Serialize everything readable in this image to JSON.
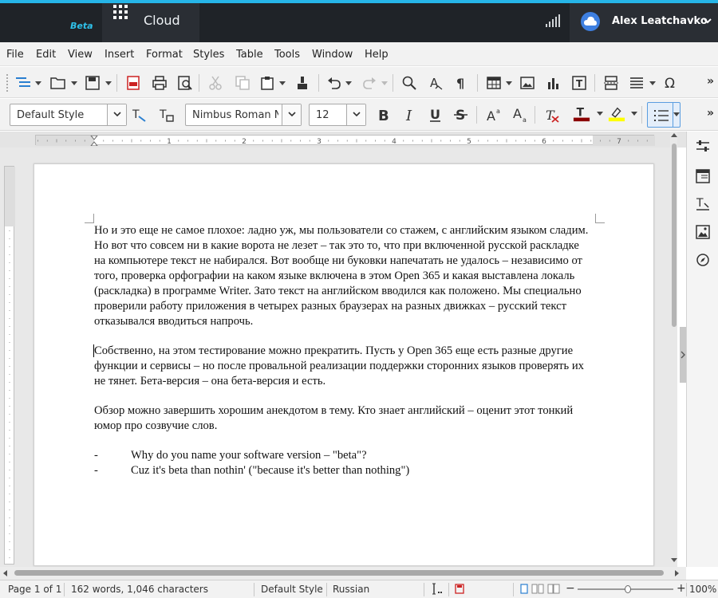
{
  "app": {
    "beta_label": "Beta",
    "product_name": "Cloud",
    "user_name": "Alex Leatchavko",
    "accent": "#26b5e8",
    "header_bg": "#1f2328"
  },
  "menu": [
    "File",
    "Edit",
    "View",
    "Insert",
    "Format",
    "Styles",
    "Table",
    "Tools",
    "Window",
    "Help"
  ],
  "formatting": {
    "paragraph_style": "Default Style",
    "font_name": "Nimbus Roman N",
    "font_size": "12",
    "font_color": "#8b0000",
    "highlight_color": "#ffff00"
  },
  "document": {
    "paragraphs": [
      "Но и это еще не самое плохое: ладно уж, мы пользователи со стажем, с английским языком сладим. Но вот что совсем ни в какие ворота не лезет – так это то, что при включенной русской раскладке на компьютере текст не набирался. Вот вообще ни буковки напечатать не удалось – независимо от того, проверка орфографии на каком языке включена в этом Open 365 и какая выставлена локаль (раскладка) в программе Writer. Зато текст на английском вводился как положено. Мы специально проверили работу приложения в четырех разных браузерах на разных движках – русский текст отказывался вводиться напрочь.",
      "Собственно, на этом тестирование можно прекратить. Пусть у Open 365 еще есть разные другие функции и сервисы – но после провальной реализации поддержки сторонних языков проверять их не тянет. Бета-версия – она бета-версия и есть.",
      "Обзор можно завершить хорошим анекдотом в тему. Кто знает английский – оценит этот тонкий юмор про созвучие слов."
    ],
    "bullet_marker": "-",
    "bullets": [
      "Why do you name your software version – \"beta\"?",
      "Cuz it's beta than nothin' (\"because it's better than nothing\")"
    ]
  },
  "ruler": {
    "numbers": [
      "1",
      "2",
      "3",
      "4",
      "5",
      "6",
      "7"
    ]
  },
  "status": {
    "page": "Page 1 of 1",
    "words": "162 words, 1,046 characters",
    "style": "Default Style",
    "language": "Russian",
    "zoom": "100%"
  },
  "icons": {
    "toolbar1": [
      "navigator-icon",
      "open-icon",
      "save-icon",
      "export-pdf-icon",
      "print-icon",
      "print-preview-icon",
      "cut-icon",
      "copy-icon",
      "paste-icon",
      "clone-formatting-icon",
      "undo-icon",
      "redo-icon",
      "find-replace-icon",
      "spelling-icon",
      "formatting-marks-icon",
      "insert-table-icon",
      "insert-image-icon",
      "insert-chart-icon",
      "insert-textbox-icon",
      "insert-page-break-icon",
      "insert-field-icon",
      "insert-special-character-icon"
    ],
    "toolbar2": [
      "update-style-icon",
      "new-style-icon",
      "bold-icon",
      "italic-icon",
      "underline-icon",
      "strikethrough-icon",
      "superscript-icon",
      "subscript-icon",
      "clear-formatting-icon",
      "font-color-icon",
      "highlight-icon",
      "list-icon"
    ],
    "sidebar": [
      "properties-icon",
      "page-icon",
      "styles-icon",
      "gallery-icon",
      "navigator-icon"
    ]
  }
}
